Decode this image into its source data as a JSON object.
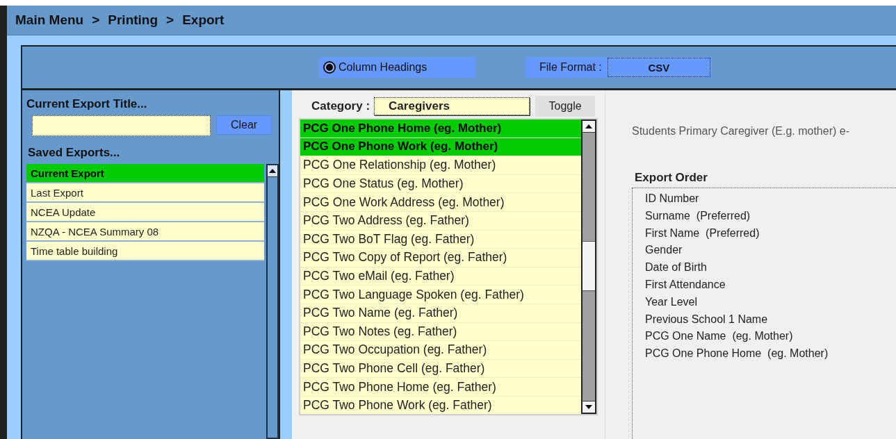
{
  "breadcrumb": [
    "Main Menu",
    ">",
    "Printing",
    ">",
    "Export"
  ],
  "toolbar": {
    "column_headings": {
      "label": "Column Headings",
      "selected": true
    },
    "file_format": {
      "label": "File Format :",
      "value": "CSV"
    }
  },
  "left_panel": {
    "title_label": "Current Export Title...",
    "clear_button": "Clear",
    "saved_label": "Saved Exports...",
    "saved_exports": [
      {
        "label": "Current Export",
        "selected": true
      },
      {
        "label": "Last Export",
        "selected": false
      },
      {
        "label": "NCEA Update",
        "selected": false
      },
      {
        "label": "NZQA - NCEA Summary 08",
        "selected": false
      },
      {
        "label": "Time table building",
        "selected": false
      }
    ]
  },
  "category": {
    "label": "Category :",
    "value": "Caregivers",
    "toggle_button": "Toggle",
    "fields": [
      {
        "label": "PCG One Phone Home  (eg. Mother)",
        "selected": true
      },
      {
        "label": "PCG One Phone Work  (eg. Mother)",
        "selected": true
      },
      {
        "label": "PCG One Relationship  (eg. Mother)",
        "selected": false
      },
      {
        "label": "PCG One Status  (eg. Mother)",
        "selected": false
      },
      {
        "label": "PCG One Work Address  (eg. Mother)",
        "selected": false
      },
      {
        "label": "PCG Two Address  (eg. Father)",
        "selected": false
      },
      {
        "label": "PCG Two BoT Flag  (eg. Father)",
        "selected": false
      },
      {
        "label": "PCG Two Copy of Report  (eg. Father)",
        "selected": false
      },
      {
        "label": "PCG Two eMail  (eg. Father)",
        "selected": false
      },
      {
        "label": "PCG Two Language Spoken  (eg. Father)",
        "selected": false
      },
      {
        "label": "PCG Two Name  (eg. Father)",
        "selected": false
      },
      {
        "label": "PCG Two Notes  (eg. Father)",
        "selected": false
      },
      {
        "label": "PCG Two Occupation  (eg. Father)",
        "selected": false
      },
      {
        "label": "PCG Two Phone Cell  (eg. Father)",
        "selected": false
      },
      {
        "label": "PCG Two Phone Home  (eg. Father)",
        "selected": false
      },
      {
        "label": "PCG Two Phone Work  (eg. Father)",
        "selected": false
      }
    ]
  },
  "description": "Students Primary Caregiver (E.g. mother)  e-",
  "export_order": {
    "title": "Export Order",
    "items": [
      "ID Number",
      "Surname  (Preferred)",
      "First Name  (Preferred)",
      "Gender",
      "Date of Birth",
      "First Attendance",
      "Year Level",
      "Previous School 1 Name",
      "PCG One Name  (eg. Mother)",
      "PCG One Phone Home  (eg. Mother)"
    ]
  }
}
